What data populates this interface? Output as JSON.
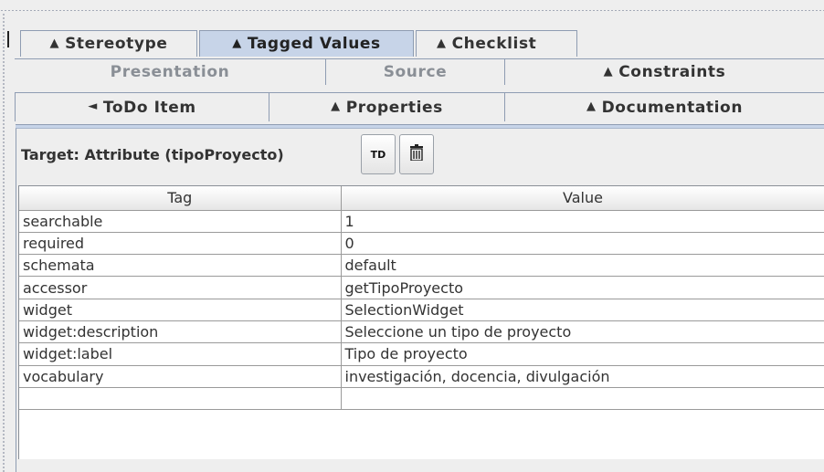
{
  "tabs": {
    "row1": [
      {
        "label": "Stereotype",
        "arrow": "▲",
        "state": "normal"
      },
      {
        "label": "Tagged Values",
        "arrow": "▲",
        "state": "selected"
      },
      {
        "label": "Checklist",
        "arrow": "▲",
        "state": "normal"
      }
    ],
    "row2": [
      {
        "label": "Presentation",
        "arrow": "",
        "state": "disabled"
      },
      {
        "label": "Source",
        "arrow": "",
        "state": "disabled"
      },
      {
        "label": "Constraints",
        "arrow": "▲",
        "state": "normal"
      }
    ],
    "row3": [
      {
        "label": "ToDo Item",
        "arrow": "◄",
        "state": "normal"
      },
      {
        "label": "Properties",
        "arrow": "▲",
        "state": "normal"
      },
      {
        "label": "Documentation",
        "arrow": "▲",
        "state": "normal"
      }
    ]
  },
  "toolbar": {
    "target_label": "Target: Attribute (tipoProyecto)",
    "td_button_label": "TD",
    "delete_icon": "trash-icon"
  },
  "table": {
    "headers": {
      "tag": "Tag",
      "value": "Value"
    },
    "rows": [
      {
        "tag": "searchable",
        "value": "1"
      },
      {
        "tag": "required",
        "value": "0"
      },
      {
        "tag": "schemata",
        "value": "default"
      },
      {
        "tag": "accessor",
        "value": "getTipoProyecto"
      },
      {
        "tag": "widget",
        "value": "SelectionWidget"
      },
      {
        "tag": "widget:description",
        "value": "Seleccione un tipo de proyecto"
      },
      {
        "tag": "widget:label",
        "value": "Tipo de proyecto"
      },
      {
        "tag": "vocabulary",
        "value": "investigación, docencia, divulgación"
      },
      {
        "tag": "",
        "value": ""
      }
    ]
  },
  "colors": {
    "selected_tab": "#c7d4e8",
    "background": "#eeeeee",
    "table_bg": "#ffffff",
    "disabled_text": "#8a8f96"
  }
}
